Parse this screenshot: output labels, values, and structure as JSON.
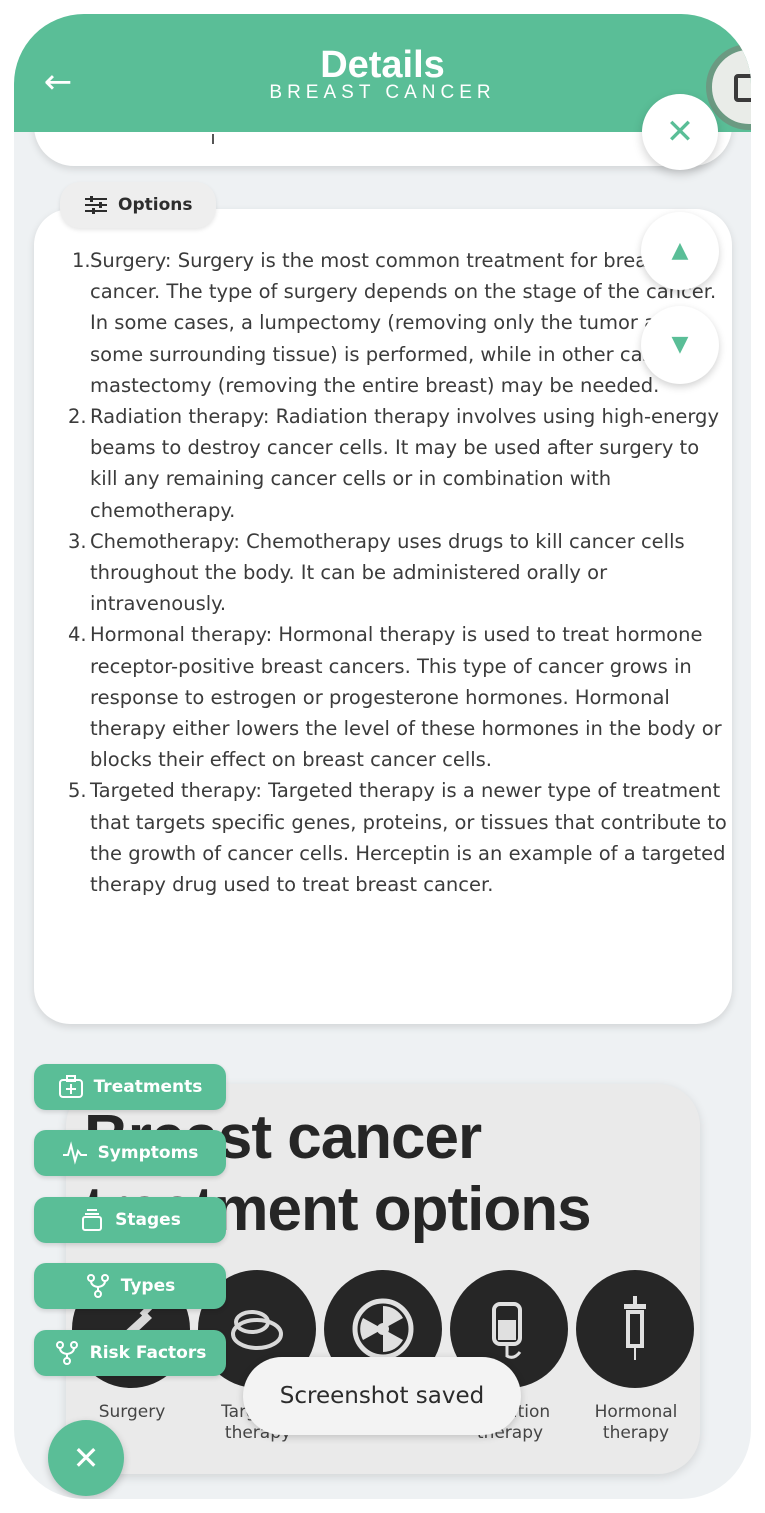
{
  "header": {
    "title": "Details",
    "subtitle": "BREAST CANCER",
    "back_icon": "arrow-left-icon",
    "close_icon": "close-icon"
  },
  "options": {
    "label": "Options",
    "icon": "sliders-icon"
  },
  "content": {
    "items": [
      {
        "num": "1.",
        "text": "Surgery: Surgery is the most common treatment for breast cancer. The type of surgery depends on the stage of the cancer. In some cases, a lumpectomy (removing only the tumor and some surrounding tissue) is performed, while in other cases a mastectomy (removing the entire breast) may be needed."
      },
      {
        "num": "2.",
        "text": "Radiation therapy: Radiation therapy involves using high-energy beams to destroy cancer cells. It may be used after surgery to kill any remaining cancer cells or in combination with chemotherapy."
      },
      {
        "num": "3.",
        "text": "Chemotherapy: Chemotherapy uses drugs to kill cancer cells throughout the body. It can be administered orally or intravenously."
      },
      {
        "num": "4.",
        "text": "Hormonal therapy: Hormonal therapy is used to treat hormone receptor-positive breast cancers. This type of cancer grows in response to estrogen or progesterone hormones. Hormonal therapy either lowers the level of these hormones in the body or blocks their effect on breast cancer cells."
      },
      {
        "num": "5.",
        "text": "Targeted therapy: Targeted therapy is a newer type of treatment that targets specific genes, proteins, or tissues that contribute to the growth of cancer cells. Herceptin is an example of a targeted therapy drug used to treat breast cancer."
      }
    ]
  },
  "infographic": {
    "title_line1": "Breast cancer",
    "title_line2": "treatment options",
    "captions": [
      "Surgery",
      "Targeted therapy",
      "",
      "Radiation therapy",
      "Hormonal therapy"
    ]
  },
  "side_menu": [
    {
      "label": "Treatments",
      "icon": "medical-kit-icon"
    },
    {
      "label": "Symptoms",
      "icon": "pulse-icon"
    },
    {
      "label": "Stages",
      "icon": "layers-icon"
    },
    {
      "label": "Types",
      "icon": "branch-icon"
    },
    {
      "label": "Risk Factors",
      "icon": "branch-icon"
    }
  ],
  "toast": {
    "text": "Screenshot saved"
  },
  "colors": {
    "accent": "#5abe97",
    "background": "#eef1f3",
    "card": "#ffffff"
  }
}
